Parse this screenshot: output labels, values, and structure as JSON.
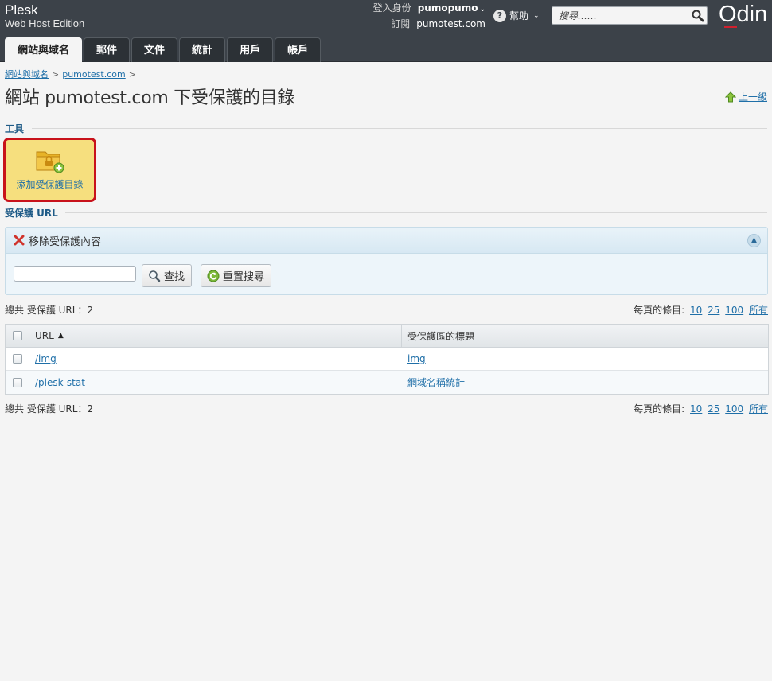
{
  "header": {
    "brand_line1": "Plesk",
    "brand_line2": "Web Host Edition",
    "login_label": "登入身份",
    "login_user": "pumopumo",
    "sub_label": "訂閱",
    "sub_value": "pumotest.com",
    "help_label": "幫助",
    "search_placeholder": "搜尋……",
    "logo": "Odin"
  },
  "tabs": [
    {
      "label": "網站與域名",
      "active": true
    },
    {
      "label": "郵件"
    },
    {
      "label": "文件"
    },
    {
      "label": "統計"
    },
    {
      "label": "用戶"
    },
    {
      "label": "帳戶"
    }
  ],
  "breadcrumb": {
    "items": [
      "網站與域名",
      "pumotest.com"
    ],
    "sep": ">"
  },
  "page": {
    "title": "網站 pumotest.com 下受保護的目錄",
    "up_label": "上一級"
  },
  "tools": {
    "section_label": "工具",
    "add_label": "添加受保護目錄"
  },
  "protected": {
    "section_label": "受保護 URL",
    "remove_label": "移除受保護內容",
    "find_label": "查找",
    "reset_label": "重置搜尋",
    "filter_value": ""
  },
  "list": {
    "total_text": "總共 受保護 URL：2",
    "perpage_label": "每頁的條目:",
    "perpage_options": [
      "10",
      "25",
      "100",
      "所有"
    ],
    "col_url": "URL",
    "col_title": "受保護區的標題",
    "rows": [
      {
        "url": "/img",
        "title": "img"
      },
      {
        "url": "/plesk-stat",
        "title": "網域名稱統計"
      }
    ]
  },
  "colors": {
    "header_bg": "#3c4249",
    "link": "#1f6fa8",
    "tool_highlight": "#f6df7e",
    "tool_border": "#c8121b"
  }
}
